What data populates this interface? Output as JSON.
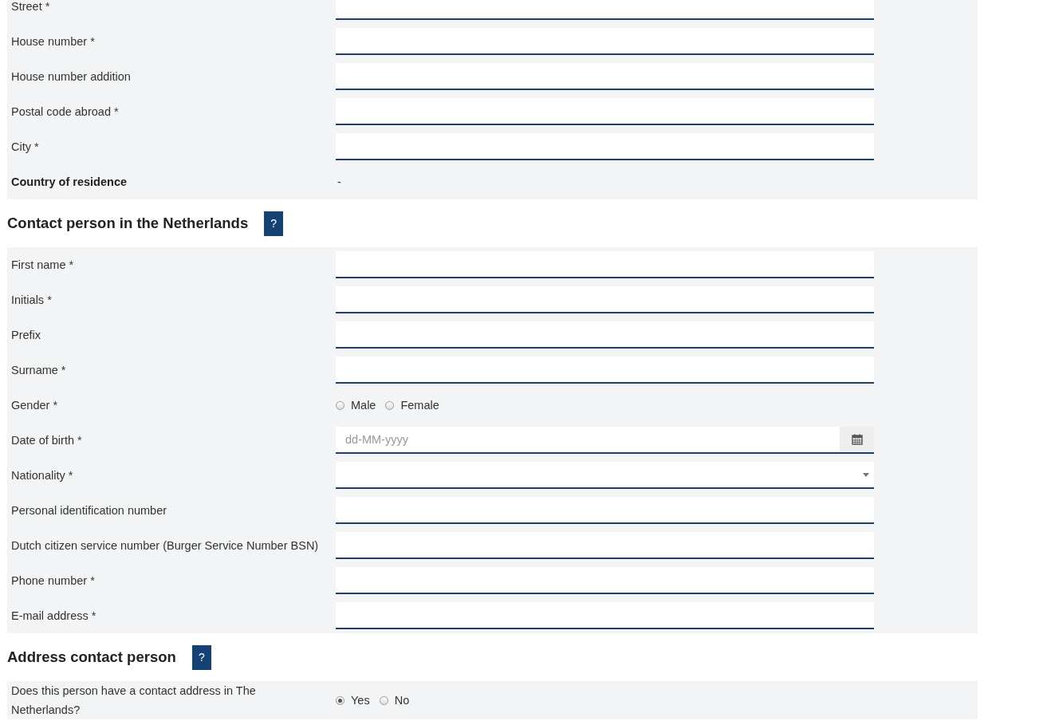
{
  "sections": [
    {
      "rows": [
        {
          "kind": "text",
          "label": "Street *"
        },
        {
          "kind": "text",
          "label": "House number *"
        },
        {
          "kind": "text",
          "label": "House number addition"
        },
        {
          "kind": "text",
          "label": "Postal code abroad *"
        },
        {
          "kind": "text",
          "label": "City *"
        },
        {
          "kind": "static",
          "label": "Country of residence",
          "value": "-"
        }
      ]
    },
    {
      "heading": "Contact person in the Netherlands",
      "help": "?",
      "rows": [
        {
          "kind": "text",
          "label": "First name *"
        },
        {
          "kind": "text",
          "label": "Initials *"
        },
        {
          "kind": "text",
          "label": "Prefix"
        },
        {
          "kind": "text",
          "label": "Surname *"
        },
        {
          "kind": "radio",
          "label": "Gender *",
          "options": [
            {
              "label": "Male",
              "selected": false
            },
            {
              "label": "Female",
              "selected": false
            }
          ]
        },
        {
          "kind": "date",
          "label": "Date of birth *",
          "placeholder": "dd-MM-yyyy"
        },
        {
          "kind": "select",
          "label": "Nationality *"
        },
        {
          "kind": "text",
          "label": "Personal identification number"
        },
        {
          "kind": "text",
          "label": "Dutch citizen service number (Burger Service Number BSN)"
        },
        {
          "kind": "text",
          "label": "Phone number *"
        },
        {
          "kind": "text",
          "label": "E-mail address *"
        }
      ]
    },
    {
      "heading": "Address contact person",
      "help": "?",
      "rows": [
        {
          "kind": "radio",
          "label": "Does this person have a contact address in The Netherlands?",
          "options": [
            {
              "label": "Yes",
              "selected": true
            },
            {
              "label": "No",
              "selected": false
            }
          ]
        }
      ]
    }
  ]
}
